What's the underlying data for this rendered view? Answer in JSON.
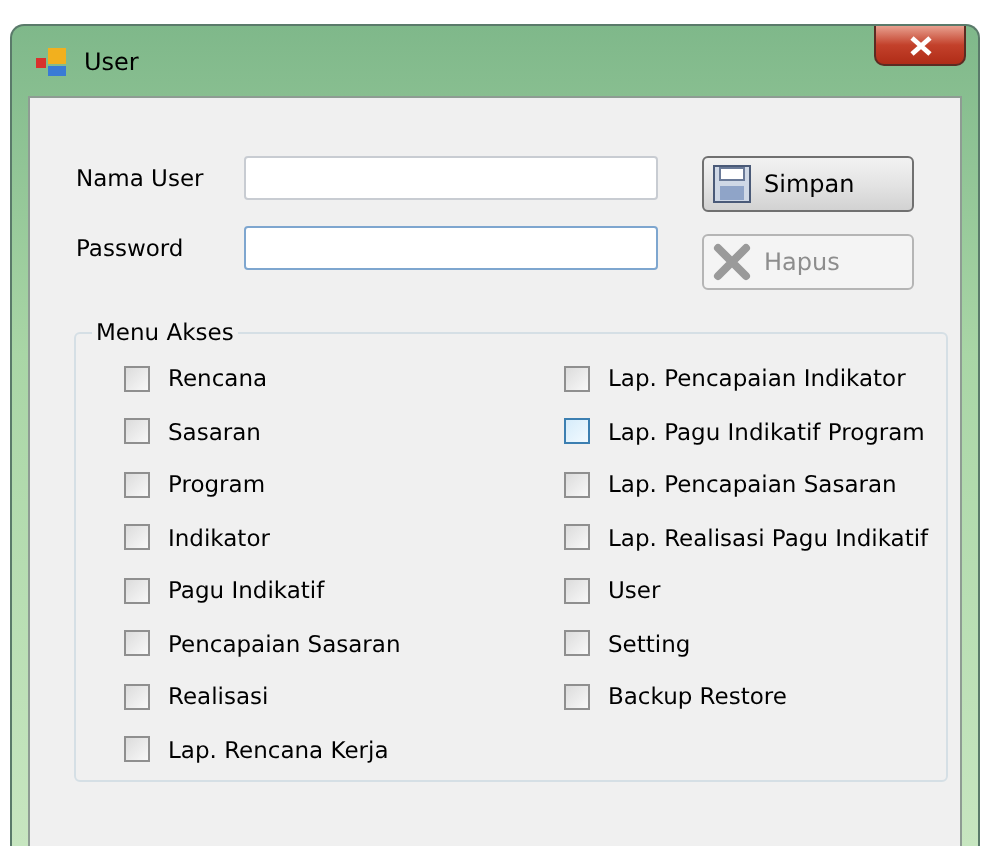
{
  "window": {
    "title": "User"
  },
  "fields": [
    {
      "label": "Nama User",
      "focused": false
    },
    {
      "label": "Password",
      "focused": true
    }
  ],
  "buttons": [
    {
      "label": "Simpan",
      "kind": "save",
      "disabled": false
    },
    {
      "label": "Hapus",
      "kind": "delete",
      "disabled": true
    }
  ],
  "menu_akses": {
    "title": "Menu Akses",
    "columns": [
      [
        {
          "label": "Rencana",
          "checked": false,
          "hovered": false
        },
        {
          "label": "Sasaran",
          "checked": false,
          "hovered": false
        },
        {
          "label": "Program",
          "checked": false,
          "hovered": false
        },
        {
          "label": "Indikator",
          "checked": false,
          "hovered": false
        },
        {
          "label": "Pagu Indikatif",
          "checked": false,
          "hovered": false
        },
        {
          "label": "Pencapaian Sasaran",
          "checked": false,
          "hovered": false
        },
        {
          "label": "Realisasi",
          "checked": false,
          "hovered": false
        },
        {
          "label": "Lap. Rencana Kerja",
          "checked": false,
          "hovered": false
        }
      ],
      [
        {
          "label": "Lap. Pencapaian Indikator",
          "checked": false,
          "hovered": false
        },
        {
          "label": "Lap. Pagu Indikatif Program",
          "checked": false,
          "hovered": true
        },
        {
          "label": "Lap. Pencapaian Sasaran",
          "checked": false,
          "hovered": false
        },
        {
          "label": "Lap. Realisasi Pagu Indikatif",
          "checked": false,
          "hovered": false
        },
        {
          "label": "User",
          "checked": false,
          "hovered": false
        },
        {
          "label": "Setting",
          "checked": false,
          "hovered": false
        },
        {
          "label": "Backup Restore",
          "checked": false,
          "hovered": false
        }
      ]
    ]
  }
}
